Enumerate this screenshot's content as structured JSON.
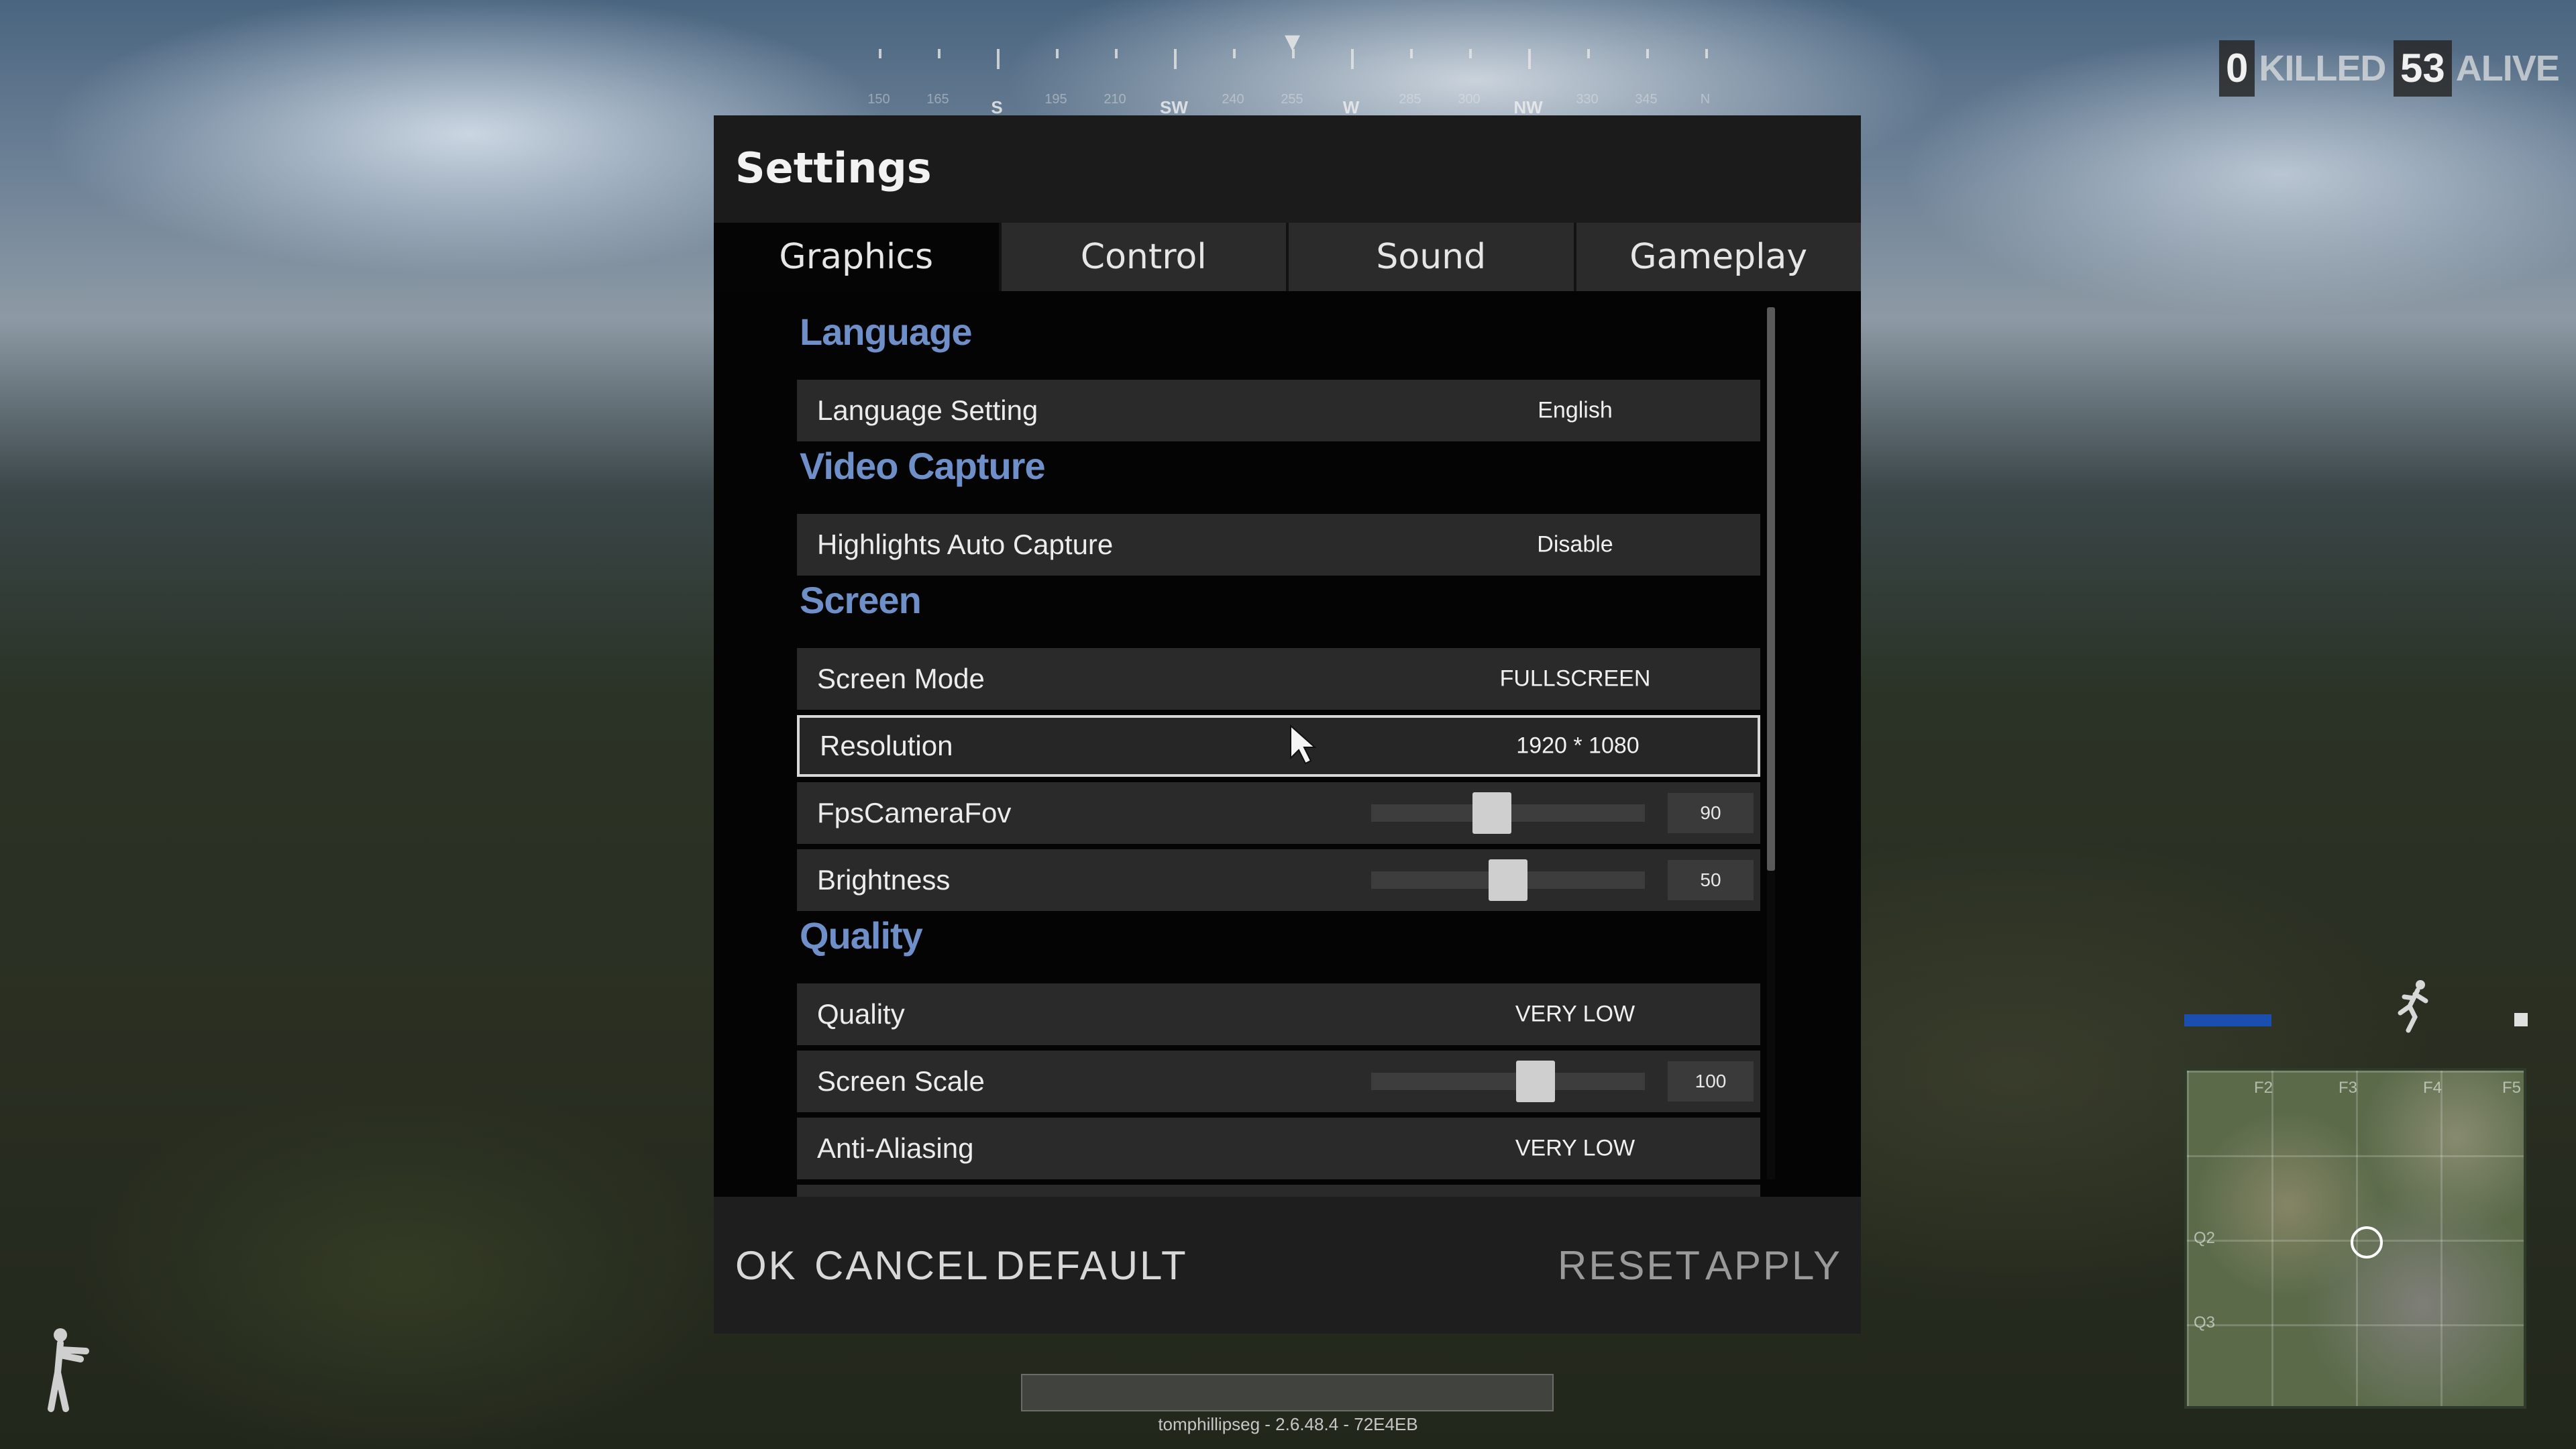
{
  "hud": {
    "compass": {
      "labels": [
        "150",
        "165",
        "S",
        "195",
        "210",
        "SW",
        "240",
        "255",
        "W",
        "285",
        "300",
        "NW",
        "330",
        "345",
        "N"
      ]
    },
    "killed": {
      "count": "0",
      "label": "KILLED"
    },
    "alive": {
      "count": "53",
      "label": "ALIVE"
    },
    "build_info": "tomphillipseg - 2.6.48.4 - 72E4EB",
    "minimap": {
      "col_labels": [
        "F2",
        "F3",
        "F4",
        "F5"
      ],
      "row_labels": [
        "Q2",
        "Q3"
      ]
    }
  },
  "settings": {
    "title": "Settings",
    "tabs": [
      {
        "label": "Graphics",
        "active": true
      },
      {
        "label": "Control",
        "active": false
      },
      {
        "label": "Sound",
        "active": false
      },
      {
        "label": "Gameplay",
        "active": false
      }
    ],
    "sections": {
      "language": {
        "header": "Language",
        "rows": [
          {
            "label": "Language Setting",
            "value": "English"
          }
        ]
      },
      "video_capture": {
        "header": "Video Capture",
        "rows": [
          {
            "label": "Highlights Auto Capture",
            "value": "Disable"
          }
        ]
      },
      "screen": {
        "header": "Screen",
        "rows": [
          {
            "label": "Screen Mode",
            "value": "FULLSCREEN"
          },
          {
            "label": "Resolution",
            "value": "1920 * 1080",
            "selected": true
          },
          {
            "label": "FpsCameraFov",
            "value": "90",
            "slider_fraction": 0.44
          },
          {
            "label": "Brightness",
            "value": "50",
            "slider_fraction": 0.5
          }
        ]
      },
      "quality": {
        "header": "Quality",
        "rows": [
          {
            "label": "Quality",
            "value": "VERY LOW"
          },
          {
            "label": "Screen Scale",
            "value": "100",
            "slider_fraction": 0.6
          },
          {
            "label": "Anti-Aliasing",
            "value": "VERY LOW"
          }
        ]
      }
    },
    "footer": {
      "ok": "OK",
      "cancel": "CANCEL",
      "default": "DEFAULT",
      "reset": "RESET",
      "apply": "APPLY"
    }
  }
}
